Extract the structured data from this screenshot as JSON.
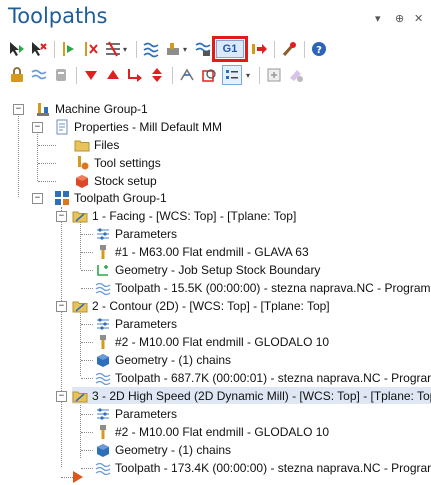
{
  "panel": {
    "title": "Toolpaths",
    "window_controls": [
      "▾",
      "⊕",
      "✕"
    ],
    "g1_label": "G1"
  },
  "tree": {
    "machine_group": "Machine Group-1",
    "properties": "Properties - Mill Default MM",
    "files": "Files",
    "tool_settings": "Tool settings",
    "stock_setup": "Stock setup",
    "toolpath_group": "Toolpath Group-1",
    "ops": [
      {
        "label": "1 - Facing - [WCS: Top] - [Tplane: Top]",
        "parameters": "Parameters",
        "tool": "#1 - M63.00 Flat endmill - GLAVA 63",
        "geometry": "Geometry - Job Setup Stock Boundary",
        "toolpath": "Toolpath - 15.5K (00:00:00) - stezna naprava.NC - Program"
      },
      {
        "label": "2 - Contour (2D) - [WCS: Top] - [Tplane: Top]",
        "parameters": "Parameters",
        "tool": "#2 - M10.00 Flat endmill - GLODALO 10",
        "geometry": "Geometry - (1) chains",
        "toolpath": "Toolpath - 687.7K (00:00:01) - stezna naprava.NC - Prograr"
      },
      {
        "label": "3 - 2D High Speed (2D Dynamic Mill) - [WCS: Top] - [Tplane: Top",
        "parameters": "Parameters",
        "tool": "#2 - M10.00 Flat endmill - GLODALO 10",
        "geometry": "Geometry - (1) chains",
        "toolpath": "Toolpath - 173.4K (00:00:00) - stezna naprava.NC - Prograr"
      }
    ]
  },
  "colors": {
    "title": "#1e5d99",
    "highlight_outline": "#e11b1b",
    "selected_row": "#dfe7f4"
  }
}
